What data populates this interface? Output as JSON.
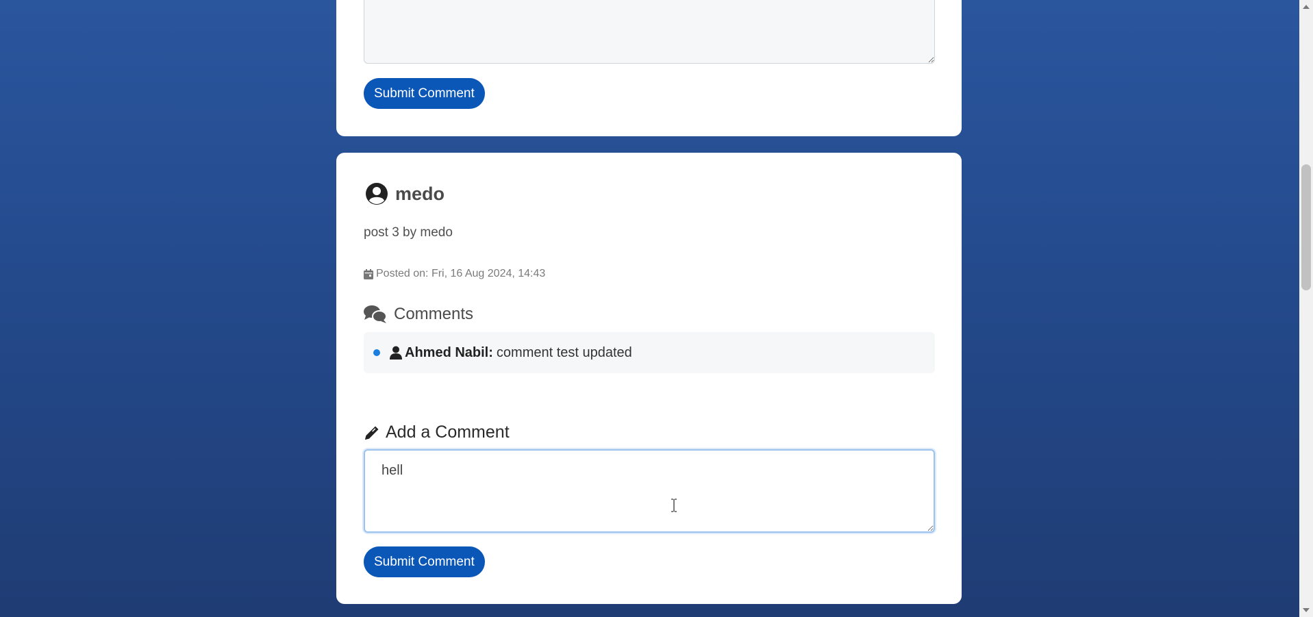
{
  "previous_card": {
    "textarea_value": "",
    "submit_label": "Submit Comment"
  },
  "post": {
    "author": "medo",
    "text": "post 3 by medo",
    "posted_on": "Posted on: Fri, 16 Aug 2024, 14:43",
    "comments_title": "Comments",
    "comments": [
      {
        "author": "Ahmed Nabil:",
        "text": "comment test updated"
      }
    ],
    "add_comment_title": "Add a Comment",
    "comment_input_value": "hell",
    "submit_label": "Submit Comment"
  },
  "colors": {
    "background_top": "#2a569e",
    "background_bottom": "#1f3c74",
    "button": "#0b57b8",
    "bullet": "#1a7fe0",
    "focus_border": "#9cc3ee"
  },
  "icons": {
    "author": "user-circle-icon",
    "date": "calendar-icon",
    "comments": "comments-icon",
    "comment_author": "user-icon",
    "add_comment": "pencil-icon"
  }
}
